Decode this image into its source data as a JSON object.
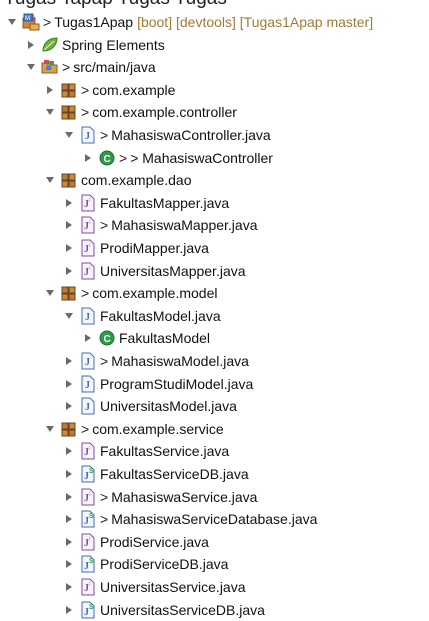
{
  "clipped_top_text": "Tugas Tapap Tugas Tugas",
  "tree": [
    {
      "depth": 0,
      "twisty": "expanded",
      "icon": "project-icon",
      "dirty": true,
      "label": "Tugas1Apap",
      "meta": "[boot] [devtools] [Tugas1Apap master]"
    },
    {
      "depth": 1,
      "twisty": "collapsed",
      "icon": "spring-leaf-icon",
      "dirty": false,
      "label": "Spring Elements",
      "meta": ""
    },
    {
      "depth": 1,
      "twisty": "expanded",
      "icon": "source-folder-icon",
      "dirty": true,
      "label": "src/main/java",
      "meta": ""
    },
    {
      "depth": 2,
      "twisty": "collapsed",
      "icon": "package-icon",
      "dirty": true,
      "label": "com.example",
      "meta": ""
    },
    {
      "depth": 2,
      "twisty": "expanded",
      "icon": "package-icon",
      "dirty": true,
      "label": "com.example.controller",
      "meta": ""
    },
    {
      "depth": 3,
      "twisty": "expanded",
      "icon": "java-file-icon",
      "dirty": true,
      "label": "MahasiswaController.java",
      "meta": ""
    },
    {
      "depth": 4,
      "twisty": "collapsed",
      "icon": "class-icon",
      "dirty": true,
      "label": "> MahasiswaController",
      "meta": ""
    },
    {
      "depth": 2,
      "twisty": "expanded",
      "icon": "package-icon",
      "dirty": false,
      "label": "com.example.dao",
      "meta": ""
    },
    {
      "depth": 3,
      "twisty": "collapsed",
      "icon": "interface-file-icon",
      "dirty": false,
      "label": "FakultasMapper.java",
      "meta": ""
    },
    {
      "depth": 3,
      "twisty": "collapsed",
      "icon": "interface-file-icon",
      "dirty": true,
      "label": "MahasiswaMapper.java",
      "meta": ""
    },
    {
      "depth": 3,
      "twisty": "collapsed",
      "icon": "interface-file-icon",
      "dirty": false,
      "label": "ProdiMapper.java",
      "meta": ""
    },
    {
      "depth": 3,
      "twisty": "collapsed",
      "icon": "interface-file-icon",
      "dirty": false,
      "label": "UniversitasMapper.java",
      "meta": ""
    },
    {
      "depth": 2,
      "twisty": "expanded",
      "icon": "package-icon",
      "dirty": true,
      "label": "com.example.model",
      "meta": ""
    },
    {
      "depth": 3,
      "twisty": "expanded",
      "icon": "java-file-icon",
      "dirty": false,
      "label": "FakultasModel.java",
      "meta": ""
    },
    {
      "depth": 4,
      "twisty": "collapsed",
      "icon": "class-icon",
      "dirty": false,
      "label": "FakultasModel",
      "meta": ""
    },
    {
      "depth": 3,
      "twisty": "collapsed",
      "icon": "java-file-icon",
      "dirty": true,
      "label": "MahasiswaModel.java",
      "meta": ""
    },
    {
      "depth": 3,
      "twisty": "collapsed",
      "icon": "java-file-icon",
      "dirty": false,
      "label": "ProgramStudiModel.java",
      "meta": ""
    },
    {
      "depth": 3,
      "twisty": "collapsed",
      "icon": "java-file-icon",
      "dirty": false,
      "label": "UniversitasModel.java",
      "meta": ""
    },
    {
      "depth": 2,
      "twisty": "expanded",
      "icon": "package-icon",
      "dirty": true,
      "label": "com.example.service",
      "meta": ""
    },
    {
      "depth": 3,
      "twisty": "collapsed",
      "icon": "interface-file-icon",
      "dirty": false,
      "label": "FakultasService.java",
      "meta": ""
    },
    {
      "depth": 3,
      "twisty": "collapsed",
      "icon": "service-file-icon",
      "dirty": false,
      "label": "FakultasServiceDB.java",
      "meta": ""
    },
    {
      "depth": 3,
      "twisty": "collapsed",
      "icon": "interface-file-icon",
      "dirty": true,
      "label": "MahasiswaService.java",
      "meta": ""
    },
    {
      "depth": 3,
      "twisty": "collapsed",
      "icon": "service-file-icon",
      "dirty": true,
      "label": "MahasiswaServiceDatabase.java",
      "meta": ""
    },
    {
      "depth": 3,
      "twisty": "collapsed",
      "icon": "interface-file-icon",
      "dirty": false,
      "label": "ProdiService.java",
      "meta": ""
    },
    {
      "depth": 3,
      "twisty": "collapsed",
      "icon": "service-file-icon",
      "dirty": false,
      "label": "ProdiServiceDB.java",
      "meta": ""
    },
    {
      "depth": 3,
      "twisty": "collapsed",
      "icon": "interface-file-icon",
      "dirty": false,
      "label": "UniversitasService.java",
      "meta": ""
    },
    {
      "depth": 3,
      "twisty": "collapsed",
      "icon": "service-file-icon",
      "dirty": false,
      "label": "UniversitasServiceDB.java",
      "meta": ""
    }
  ],
  "dirty_marker": ">",
  "colors": {
    "twisty": "#6b6b6b",
    "meta_text": "#a07a3a",
    "package_brown": "#8a5a2b",
    "java_blue": "#3f6fb5",
    "class_green": "#2e9b4a",
    "spring_green": "#6cb33f",
    "interface_purple": "#7b4fa0"
  }
}
